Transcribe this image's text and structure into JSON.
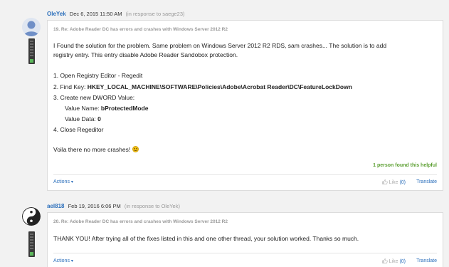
{
  "posts": [
    {
      "author": "OleYek",
      "date": "Dec 6, 2015 11:50 AM",
      "in_response": "(in response to saege23)",
      "subject": "19. Re: Adobe Reader DC has errors and crashes with Windows Server 2012 R2",
      "intro_line1": "I Found the solution for the problem. Same problem on Windows Server 2012 R2 RDS, sam crashes... The solution is to add",
      "intro_line2": "registry entry. This entry disable Adobe Reader Sandobox protection.",
      "step1": "1. Open Registry Editor - Regedit",
      "step2_label": "2. Find Key: ",
      "step2_key": "HKEY_LOCAL_MACHINE\\SOFTWARE\\Policies\\Adobe\\Acrobat Reader\\DC\\FeatureLockDown",
      "step3": "3. Create new DWORD Value:",
      "value_name_label": "Value Name: ",
      "value_name": "bProtectedMode",
      "value_data_label": "Value Data: ",
      "value_data": "0",
      "step4": "4. Close Regeditor",
      "closing": "Voila there no more crashes!",
      "helpful": "1 person found this helpful",
      "actions": "Actions",
      "like_label": "Like ",
      "like_count": "(0)",
      "translate": "Translate"
    },
    {
      "author": "ael818",
      "date": "Feb 19, 2016 6:06 PM",
      "in_response": "(in response to OleYek)",
      "subject": "20. Re: Adobe Reader DC has errors and crashes with Windows Server 2012 R2",
      "body": "THANK YOU! After trying all of the fixes listed in this and one other thread, your solution worked. Thanks so much.",
      "actions": "Actions",
      "like_label": "Like ",
      "like_count": "(0)",
      "translate": "Translate"
    }
  ],
  "icons": {
    "caret": "▾",
    "thumb": "thumbs-up-icon"
  }
}
